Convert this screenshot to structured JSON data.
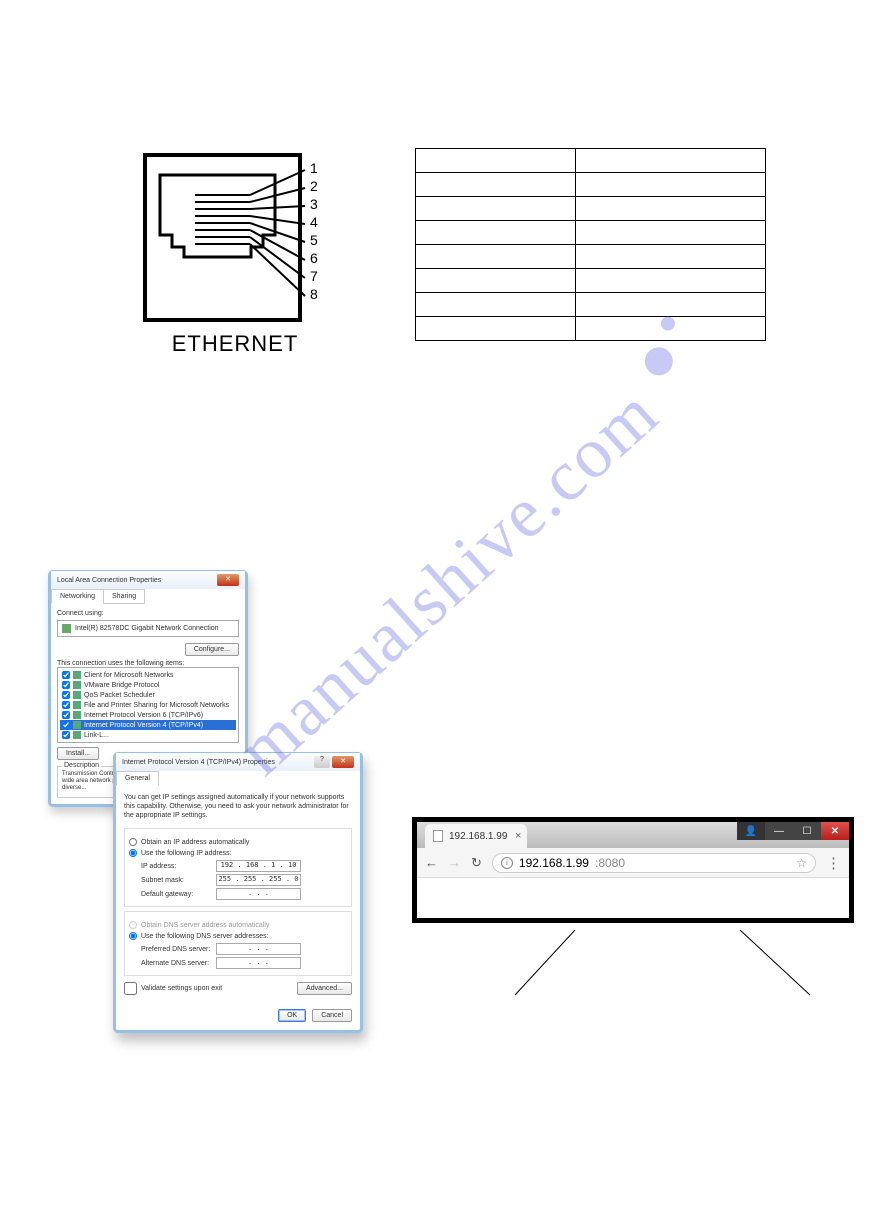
{
  "ethernet": {
    "label": "ETHERNET",
    "pins": [
      "1",
      "2",
      "3",
      "4",
      "5",
      "6",
      "7",
      "8"
    ]
  },
  "watermark": "manualshive.com",
  "lan_dialog": {
    "title": "Local Area Connection Properties",
    "tabs": {
      "networking": "Networking",
      "sharing": "Sharing"
    },
    "connect_using_label": "Connect using:",
    "adapter": "Intel(R) 82578DC Gigabit Network Connection",
    "configure_btn": "Configure...",
    "items_label": "This connection uses the following items:",
    "items": [
      "Client for Microsoft Networks",
      "VMware Bridge Protocol",
      "QoS Packet Scheduler",
      "File and Printer Sharing for Microsoft Networks",
      "Internet Protocol Version 6 (TCP/IPv6)",
      "Internet Protocol Version 4 (TCP/IPv4)",
      "Link-L..."
    ],
    "install_btn": "Install...",
    "description_label": "Description",
    "description_text": "Transmission Control Protocol/Internet Protocol. The default wide area network protocol that provides communication across diverse..."
  },
  "ipv4_dialog": {
    "title": "Internet Protocol Version 4 (TCP/IPv4) Properties",
    "tab": "General",
    "info_text": "You can get IP settings assigned automatically if your network supports this capability. Otherwise, you need to ask your network administrator for the appropriate IP settings.",
    "obtain_auto": "Obtain an IP address automatically",
    "use_following": "Use the following IP address:",
    "ip_label": "IP address:",
    "ip_value": "192 . 168 .  1  . 10",
    "subnet_label": "Subnet mask:",
    "subnet_value": "255 . 255 . 255 .  0",
    "gateway_label": "Default gateway:",
    "gateway_value": ".       .       .",
    "obtain_dns_auto": "Obtain DNS server address automatically",
    "use_dns_following": "Use the following DNS server addresses:",
    "pref_dns_label": "Preferred DNS server:",
    "pref_dns_value": ".       .       .",
    "alt_dns_label": "Alternate DNS server:",
    "alt_dns_value": ".       .       .",
    "validate_label": "Validate settings upon exit",
    "advanced_btn": "Advanced...",
    "ok_btn": "OK",
    "cancel_btn": "Cancel"
  },
  "browser": {
    "tab_title": "192.168.1.99",
    "url_ip": "192.168.1.99",
    "url_port": ":8080"
  }
}
